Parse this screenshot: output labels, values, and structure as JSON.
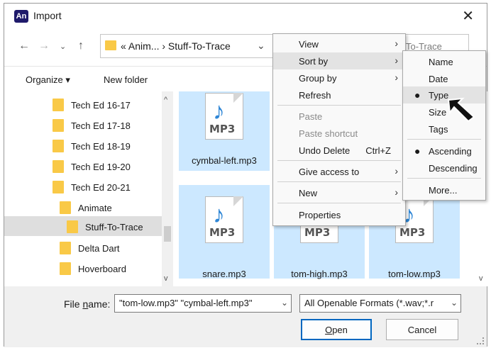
{
  "window": {
    "title": "Import",
    "app_icon": "An"
  },
  "nav": {
    "address": "« Anim... › Stuff-To-Trace",
    "search_placeholder": "To-Trace"
  },
  "toolbar": {
    "organize": "Organize ▾",
    "new_folder": "New folder"
  },
  "tree": [
    "Tech Ed 16-17",
    "Tech Ed 17-18",
    "Tech Ed 18-19",
    "Tech Ed 19-20",
    "Tech Ed 20-21",
    "Animate",
    "Stuff-To-Trace",
    "Delta Dart",
    "Hoverboard"
  ],
  "files": {
    "badge": "MP3",
    "items": [
      "cymbal-left.mp3",
      "snare.mp3",
      "tom-high.mp3",
      "tom-low.mp3"
    ]
  },
  "context_menu": {
    "view": "View",
    "sort_by": "Sort by",
    "group_by": "Group by",
    "refresh": "Refresh",
    "paste": "Paste",
    "paste_shortcut": "Paste shortcut",
    "undo_delete": "Undo Delete",
    "undo_shortcut": "Ctrl+Z",
    "give_access": "Give access to",
    "new": "New",
    "properties": "Properties"
  },
  "sort_menu": {
    "name": "Name",
    "date": "Date",
    "type": "Type",
    "size": "Size",
    "tags": "Tags",
    "ascending": "Ascending",
    "descending": "Descending",
    "more": "More..."
  },
  "bottom": {
    "file_name_label_pre": "File ",
    "file_name_label_u": "n",
    "file_name_label_post": "ame:",
    "file_name_value": "\"tom-low.mp3\" \"cymbal-left.mp3\"",
    "file_type_value": "All Openable Formats (*.wav;*.r",
    "open_u": "O",
    "open_rest": "pen",
    "cancel": "Cancel"
  }
}
